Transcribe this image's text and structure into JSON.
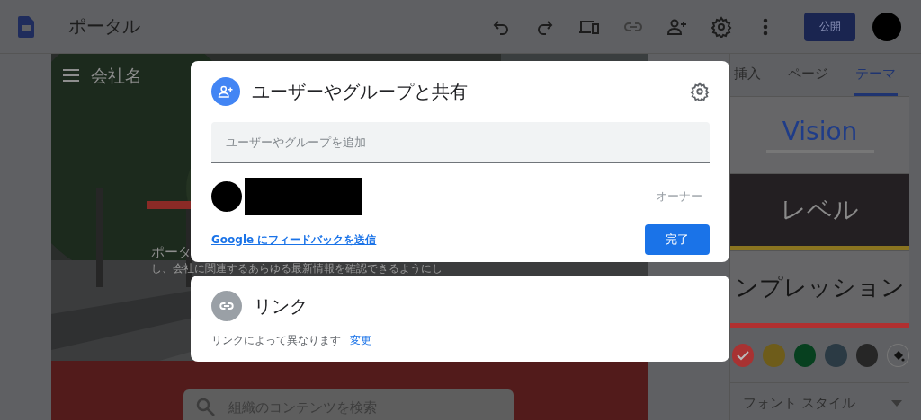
{
  "app_bar": {
    "title": "ポータル",
    "publish_button": "公開"
  },
  "page_preview": {
    "site_name": "会社名",
    "intro_lines": [
      "ポータ",
      "し、会社に関連するあらゆる最新情報を確認できるようにし"
    ],
    "search": {
      "placeholder": "組織のコンテンツを検索"
    }
  },
  "side_panel": {
    "tabs": [
      {
        "label": "挿入",
        "selected": false
      },
      {
        "label": "ページ",
        "selected": false
      },
      {
        "label": "テーマ",
        "selected": true
      }
    ],
    "themes": [
      {
        "name": "Vision",
        "kind": "light",
        "color": "#1f3c88"
      },
      {
        "name": "レベル",
        "kind": "dark",
        "color": "#8a7420"
      },
      {
        "name": "ンプレッション",
        "kind": "plain",
        "color": "#b03030"
      }
    ],
    "swatches": [
      {
        "color": "#a83232",
        "selected": true
      },
      {
        "color": "#6e5c1a",
        "selected": false
      },
      {
        "color": "#07401f",
        "selected": false
      },
      {
        "color": "#2b3a44",
        "selected": false
      },
      {
        "color": "#262626",
        "selected": false
      }
    ],
    "font_style": "フォント スタイル"
  },
  "share_dialog": {
    "title": "ユーザーやグループと共有",
    "add_field": {
      "placeholder": "ユーザーやグループを追加"
    },
    "members": [
      {
        "role": "オーナー"
      }
    ],
    "feedback_link": "Google にフィードバックを送信",
    "done_button": "完了"
  },
  "link_dialog": {
    "title": "リンク",
    "description": "リンクによって異なります",
    "change_link": "変更"
  }
}
